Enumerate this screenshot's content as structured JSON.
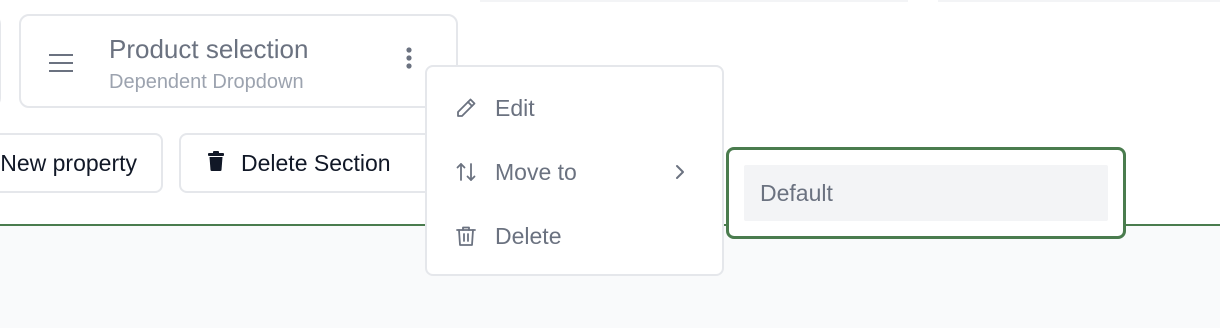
{
  "property_card": {
    "title": "Product selection",
    "subtitle": "Dependent Dropdown"
  },
  "actions": {
    "new_property_label": "New property",
    "delete_section_label": "Delete Section"
  },
  "context_menu": {
    "items": [
      {
        "label": "Edit",
        "icon": "pencil-icon"
      },
      {
        "label": "Move to",
        "icon": "arrows-up-down-icon",
        "has_submenu": true
      },
      {
        "label": "Delete",
        "icon": "trash-icon"
      }
    ]
  },
  "submenu": {
    "options": [
      {
        "label": "Default"
      }
    ]
  },
  "colors": {
    "accent_green": "#4a7c4e",
    "border": "#e5e7eb",
    "muted_text": "#6b7280"
  }
}
